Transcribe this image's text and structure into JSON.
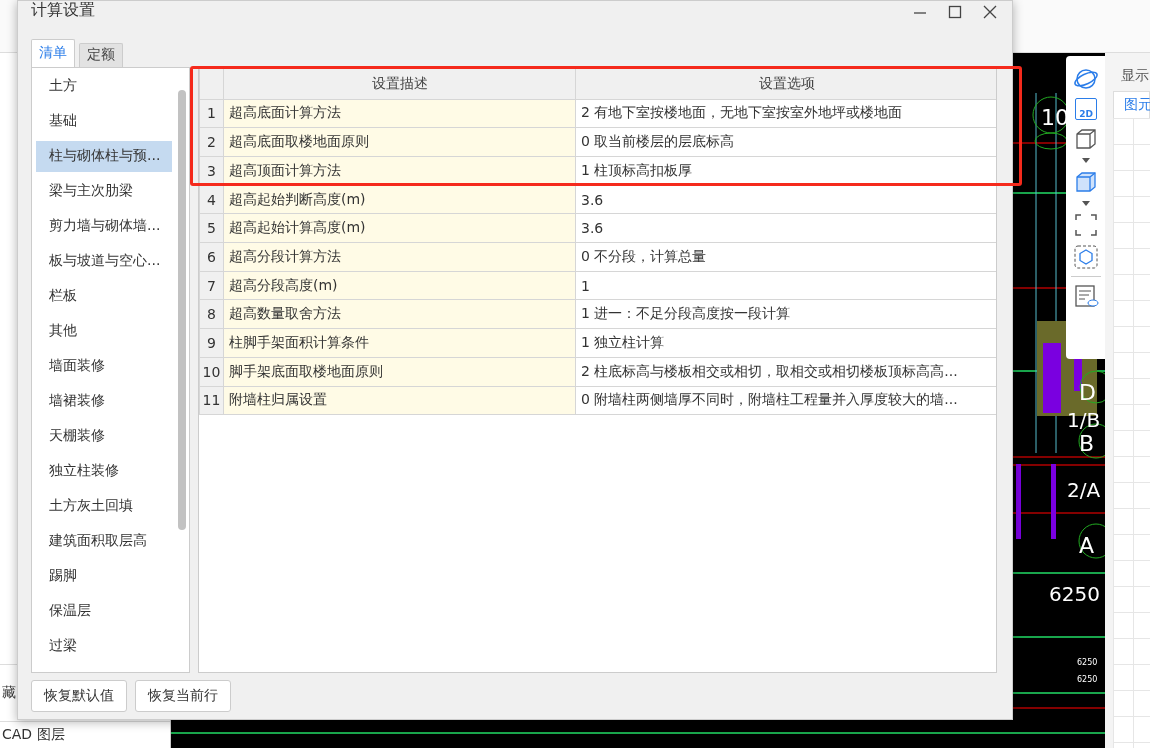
{
  "background": {
    "left_panel": {
      "texts": [
        "藏",
        "CAD 图层"
      ]
    },
    "cad_labels": [
      "10",
      "D",
      "1/B",
      "B",
      "2/A",
      "A",
      "6250",
      "6250",
      "6250"
    ],
    "toolbar": {
      "view_2d": "2D"
    },
    "right_panel": {
      "header": "显示",
      "tab": "图元"
    }
  },
  "dialog": {
    "title": "计算设置",
    "tabs": [
      {
        "label": "清单",
        "selected": true
      },
      {
        "label": "定额",
        "selected": false
      }
    ],
    "categories": [
      {
        "label": "土方",
        "selected": false
      },
      {
        "label": "基础",
        "selected": false
      },
      {
        "label": "柱与砌体柱与预...",
        "selected": true
      },
      {
        "label": "梁与主次肋梁",
        "selected": false
      },
      {
        "label": "剪力墙与砌体墙...",
        "selected": false
      },
      {
        "label": "板与坡道与空心...",
        "selected": false
      },
      {
        "label": "栏板",
        "selected": false
      },
      {
        "label": "其他",
        "selected": false
      },
      {
        "label": "墙面装修",
        "selected": false
      },
      {
        "label": "墙裙装修",
        "selected": false
      },
      {
        "label": "天棚装修",
        "selected": false
      },
      {
        "label": "独立柱装修",
        "selected": false
      },
      {
        "label": "土方灰土回填",
        "selected": false
      },
      {
        "label": "建筑面积取层高",
        "selected": false
      },
      {
        "label": "踢脚",
        "selected": false
      },
      {
        "label": "保温层",
        "selected": false
      },
      {
        "label": "过梁",
        "selected": false
      }
    ],
    "table": {
      "columns": [
        "设置描述",
        "设置选项"
      ],
      "rows": [
        {
          "number": "1",
          "description": "超高底面计算方法",
          "option": "2 有地下室按楼地面，无地下室按室外地坪或楼地面"
        },
        {
          "number": "2",
          "description": "超高底面取楼地面原则",
          "option": "0 取当前楼层的层底标高"
        },
        {
          "number": "3",
          "description": "超高顶面计算方法",
          "option": "1 柱顶标高扣板厚"
        },
        {
          "number": "4",
          "description": "超高起始判断高度(m)",
          "option": "3.6"
        },
        {
          "number": "5",
          "description": "超高起始计算高度(m)",
          "option": "3.6"
        },
        {
          "number": "6",
          "description": "超高分段计算方法",
          "option": "0 不分段，计算总量"
        },
        {
          "number": "7",
          "description": "超高分段高度(m)",
          "option": "1"
        },
        {
          "number": "8",
          "description": "超高数量取舍方法",
          "option": "1 进一：不足分段高度按一段计算"
        },
        {
          "number": "9",
          "description": "柱脚手架面积计算条件",
          "option": "1 独立柱计算"
        },
        {
          "number": "10",
          "description": "脚手架底面取楼地面原则",
          "option": "2 柱底标高与楼板相交或相切，取相交或相切楼板顶标高高..."
        },
        {
          "number": "11",
          "description": "附墙柱归属设置",
          "option": "0 附墙柱两侧墙厚不同时，附墙柱工程量并入厚度较大的墙..."
        }
      ]
    },
    "buttons": [
      "恢复默认值",
      "恢复当前行"
    ]
  },
  "highlight_frame": {
    "visible": true
  }
}
